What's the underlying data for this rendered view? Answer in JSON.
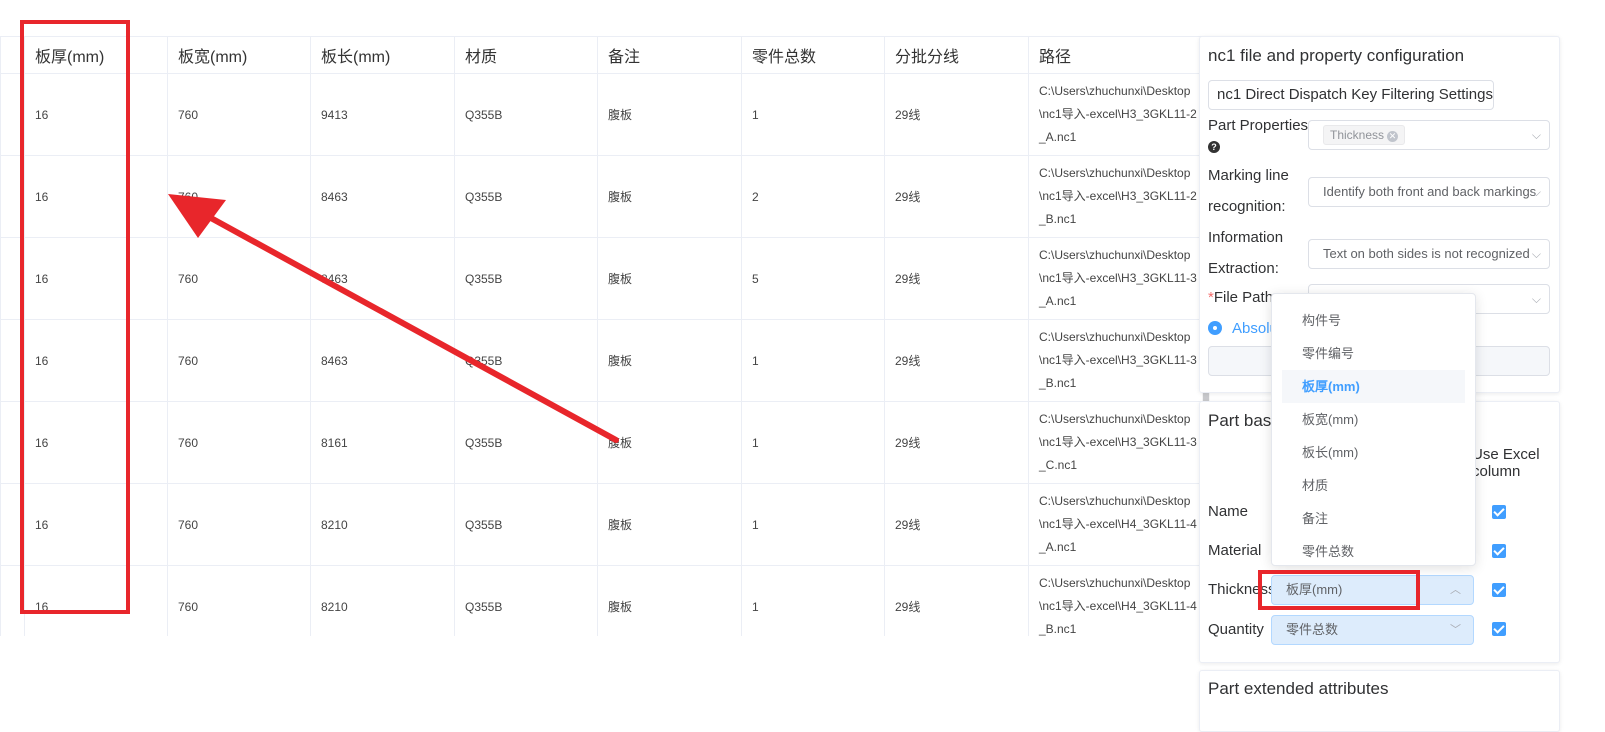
{
  "table": {
    "headers": [
      "板厚(mm)",
      "板宽(mm)",
      "板长(mm)",
      "材质",
      "备注",
      "零件总数",
      "分批分线",
      "路径"
    ],
    "rows": [
      {
        "thickness": "16",
        "width": "760",
        "length": "9413",
        "material": "Q355B",
        "remark": "腹板",
        "quantity": "1",
        "batch": "29线",
        "path": "C:\\Users\\zhuchunxi\\Desktop\\nc1导入-excel\\H3_3GKL11-2_A.nc1"
      },
      {
        "thickness": "16",
        "width": "760",
        "length": "8463",
        "material": "Q355B",
        "remark": "腹板",
        "quantity": "2",
        "batch": "29线",
        "path": "C:\\Users\\zhuchunxi\\Desktop\\nc1导入-excel\\H3_3GKL11-2_B.nc1"
      },
      {
        "thickness": "16",
        "width": "760",
        "length": "8463",
        "material": "Q355B",
        "remark": "腹板",
        "quantity": "5",
        "batch": "29线",
        "path": "C:\\Users\\zhuchunxi\\Desktop\\nc1导入-excel\\H3_3GKL11-3_A.nc1"
      },
      {
        "thickness": "16",
        "width": "760",
        "length": "8463",
        "material": "Q355B",
        "remark": "腹板",
        "quantity": "1",
        "batch": "29线",
        "path": "C:\\Users\\zhuchunxi\\Desktop\\nc1导入-excel\\H3_3GKL11-3_B.nc1"
      },
      {
        "thickness": "16",
        "width": "760",
        "length": "8161",
        "material": "Q355B",
        "remark": "腹板",
        "quantity": "1",
        "batch": "29线",
        "path": "C:\\Users\\zhuchunxi\\Desktop\\nc1导入-excel\\H3_3GKL11-3_C.nc1"
      },
      {
        "thickness": "16",
        "width": "760",
        "length": "8210",
        "material": "Q355B",
        "remark": "腹板",
        "quantity": "1",
        "batch": "29线",
        "path": "C:\\Users\\zhuchunxi\\Desktop\\nc1导入-excel\\H4_3GKL11-4_A.nc1"
      },
      {
        "thickness": "16",
        "width": "760",
        "length": "8210",
        "material": "Q355B",
        "remark": "腹板",
        "quantity": "1",
        "batch": "29线",
        "path": "C:\\Users\\zhuchunxi\\Desktop\\nc1导入-excel\\H4_3GKL11-4_B.nc1"
      }
    ]
  },
  "config_panel": {
    "title": "nc1 file and property configuration",
    "dispatch_button": "nc1 Direct Dispatch Key Filtering Settings",
    "part_properties_label": "Part Properties",
    "part_properties_tag": "Thickness",
    "marking_label_1": "Marking line",
    "marking_label_2": "recognition:",
    "marking_value": "Identify both front and back markings",
    "info_label_1": "Information",
    "info_label_2": "Extraction:",
    "info_value": "Text on both sides is not recognized",
    "file_path_star": "*",
    "file_path_label": "File Path",
    "radio_label": "Absolute"
  },
  "basic_panel": {
    "title": "Part basic",
    "use_excel_1": "Use Excel",
    "use_excel_2": "column",
    "rows": [
      {
        "label": "Name"
      },
      {
        "label": "Material"
      },
      {
        "label": "Thickness",
        "value": "板厚(mm)"
      },
      {
        "label": "Quantity",
        "value": "零件总数"
      }
    ]
  },
  "dropdown": {
    "options": [
      "构件号",
      "零件编号",
      "板厚(mm)",
      "板宽(mm)",
      "板长(mm)",
      "材质",
      "备注",
      "零件总数"
    ],
    "selected_index": 2
  },
  "extended_panel": {
    "title": "Part extended attributes"
  },
  "colors": {
    "accent": "#409eff",
    "annotation_red": "#e8262b",
    "selected_select_bg": "#ddecfc"
  }
}
